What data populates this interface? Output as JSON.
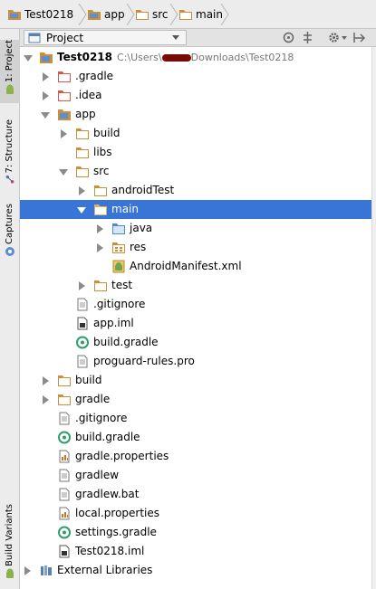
{
  "breadcrumb": [
    "Test0218",
    "app",
    "src",
    "main"
  ],
  "header": {
    "title": "Project"
  },
  "left_tabs": {
    "project": "1: Project",
    "structure": "7: Structure",
    "captures": "Captures",
    "build_variants": "Build Variants"
  },
  "tree": {
    "root_label": "Test0218",
    "root_path_prefix": "C:\\Users\\",
    "root_path_suffix": "Downloads\\Test0218",
    "gradle_dir": ".gradle",
    "idea_dir": ".idea",
    "app_dir": "app",
    "app_build": "build",
    "app_libs": "libs",
    "app_src": "src",
    "android_test": "androidTest",
    "main": "main",
    "java": "java",
    "res": "res",
    "manifest": "AndroidManifest.xml",
    "test": "test",
    "app_gitignore": ".gitignore",
    "app_iml": "app.iml",
    "app_build_gradle": "build.gradle",
    "proguard": "proguard-rules.pro",
    "root_build": "build",
    "root_gradle": "gradle",
    "root_gitignore": ".gitignore",
    "root_build_gradle": "build.gradle",
    "gradle_properties": "gradle.properties",
    "gradlew": "gradlew",
    "gradlew_bat": "gradlew.bat",
    "local_properties": "local.properties",
    "settings_gradle": "settings.gradle",
    "project_iml": "Test0218.iml",
    "external_libraries": "External Libraries"
  },
  "colors": {
    "selection": "#3875d6",
    "folder": "#c98f3b",
    "excluded_folder": "#d25a4c",
    "source_folder": "#4a8bd6"
  }
}
